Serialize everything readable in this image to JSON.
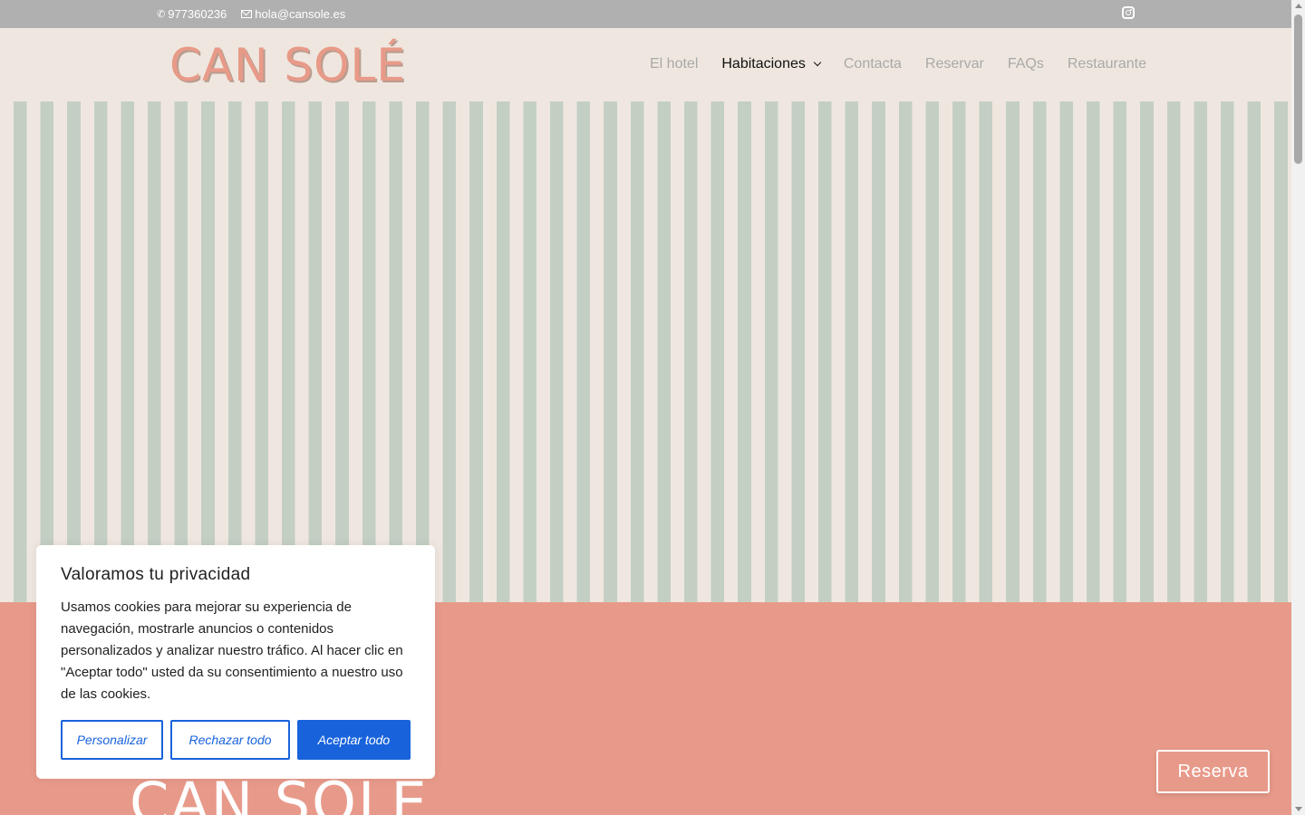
{
  "topbar": {
    "phone": "977360236",
    "email": "hola@cansole.es",
    "social_icon": "instagram-icon"
  },
  "header": {
    "logo_text": "CAN SOLÉ",
    "nav": [
      {
        "label": "El hotel",
        "active": false
      },
      {
        "label": "Habitaciones",
        "active": true,
        "has_dropdown": true
      },
      {
        "label": "Contacta",
        "active": false
      },
      {
        "label": "Reservar",
        "active": false
      },
      {
        "label": "FAQs",
        "active": false
      },
      {
        "label": "Restaurante",
        "active": false
      }
    ]
  },
  "hero": {
    "stripe_colors": [
      "#efe7df",
      "#c4cfc4"
    ]
  },
  "section": {
    "background": "#e89a8a",
    "logo_text": "CAN SOLÉ"
  },
  "cookie": {
    "title": "Valoramos tu privacidad",
    "body": "Usamos cookies para mejorar su experiencia de navegación, mostrarle anuncios o contenidos personalizados y analizar nuestro tráfico. Al hacer clic en \"Aceptar todo\" usted da su consentimiento a nuestro uso de las cookies.",
    "customize_label": "Personalizar",
    "reject_label": "Rechazar todo",
    "accept_label": "Aceptar todo",
    "accent": "#1863dc"
  },
  "floating": {
    "reserva_label": "Reserva"
  }
}
